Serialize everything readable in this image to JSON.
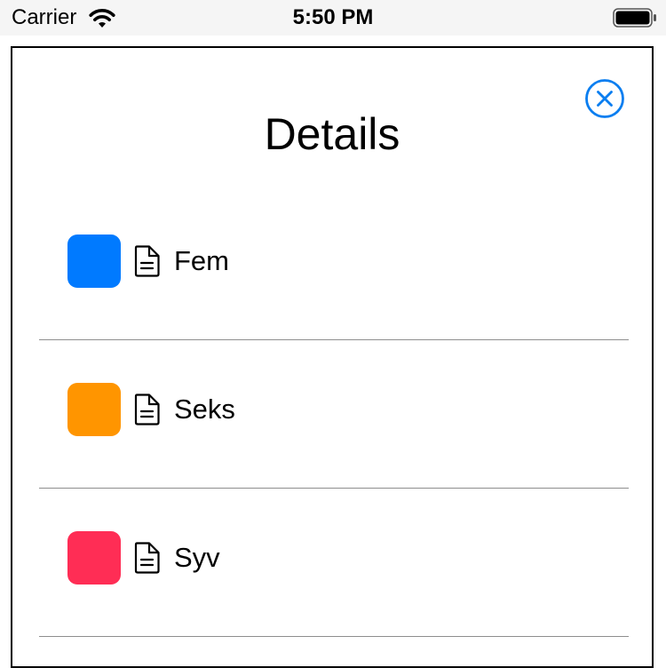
{
  "status_bar": {
    "carrier": "Carrier",
    "time": "5:50 PM",
    "wifi_icon": "wifi-icon",
    "battery_icon": "battery-full-icon"
  },
  "sheet": {
    "title": "Details",
    "close_icon": "close-circle-icon",
    "accent_color": "#0a7ef0",
    "items": [
      {
        "label": "Fem",
        "color": "#007aff",
        "icon": "document-icon"
      },
      {
        "label": "Seks",
        "color": "#ff9500",
        "icon": "document-icon"
      },
      {
        "label": "Syv",
        "color": "#ff2d55",
        "icon": "document-icon"
      }
    ]
  }
}
